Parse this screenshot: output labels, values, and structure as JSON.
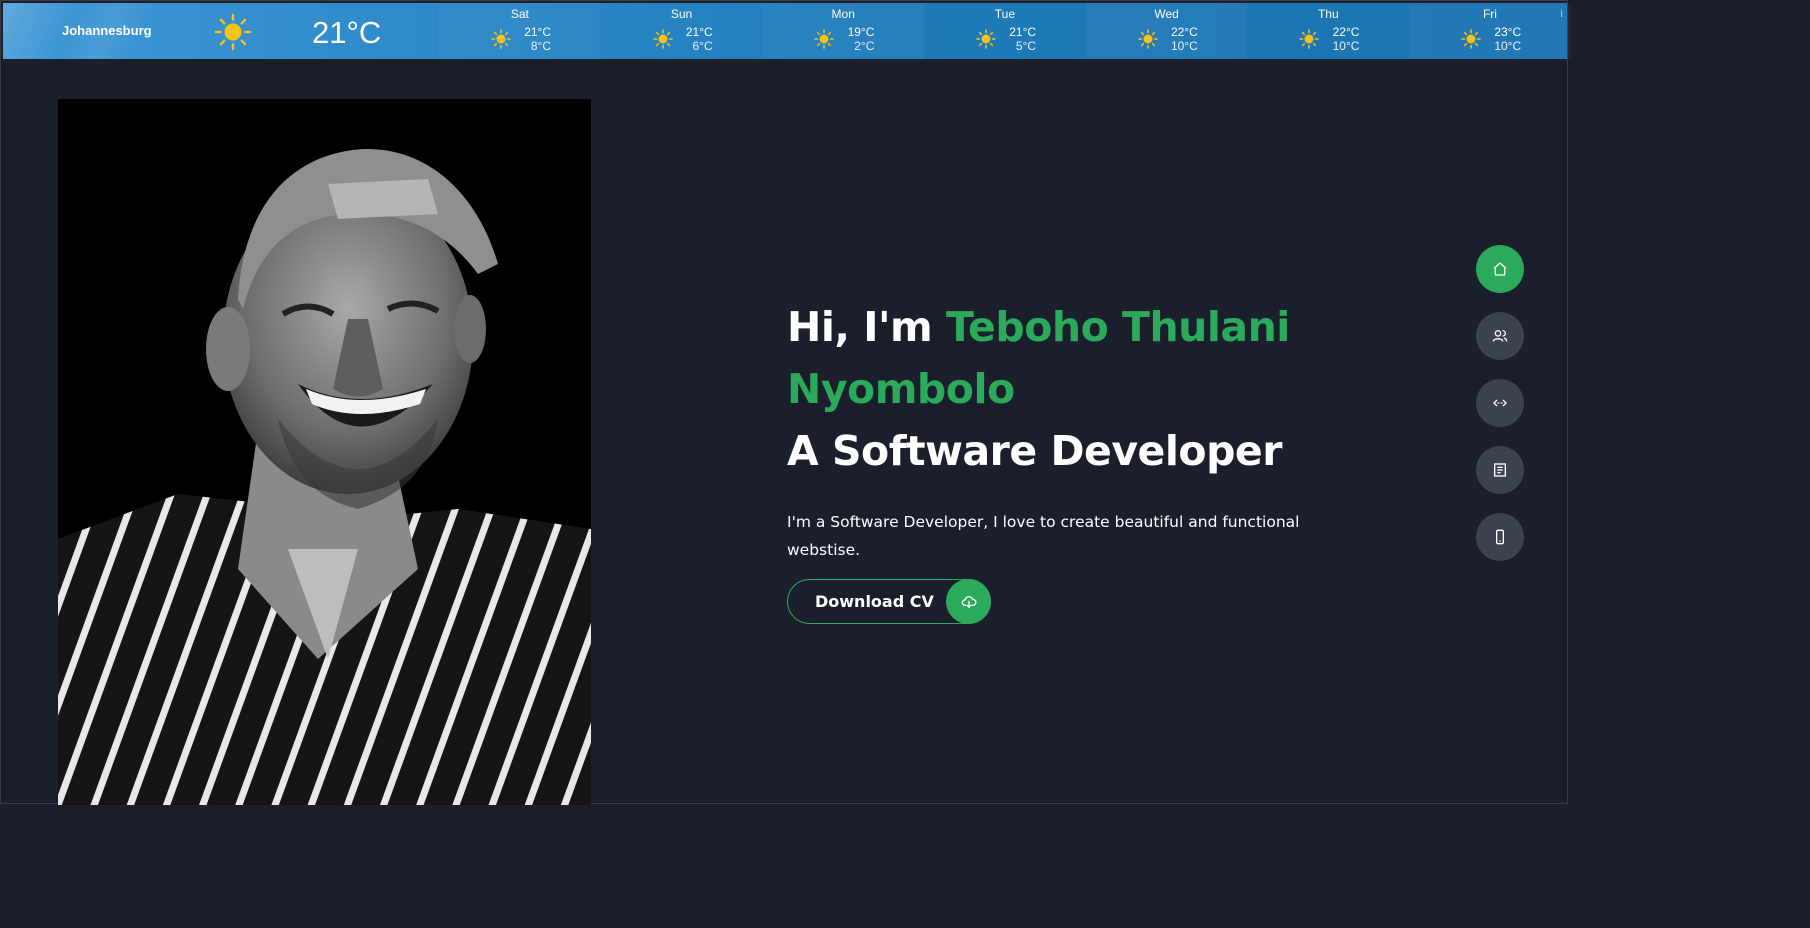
{
  "weather": {
    "city": "Johannesburg",
    "current_temp": "21°C",
    "current_icon": "sun-icon",
    "forecast": [
      {
        "day": "Sat",
        "high": "21°C",
        "low": "8°C",
        "icon": "sun-icon"
      },
      {
        "day": "Sun",
        "high": "21°C",
        "low": "6°C",
        "icon": "sun-icon"
      },
      {
        "day": "Mon",
        "high": "19°C",
        "low": "2°C",
        "icon": "sun-icon"
      },
      {
        "day": "Tue",
        "high": "21°C",
        "low": "5°C",
        "icon": "sun-icon"
      },
      {
        "day": "Wed",
        "high": "22°C",
        "low": "10°C",
        "icon": "sun-icon"
      },
      {
        "day": "Thu",
        "high": "22°C",
        "low": "10°C",
        "icon": "sun-icon"
      },
      {
        "day": "Fri",
        "high": "23°C",
        "low": "10°C",
        "icon": "sun-icon"
      }
    ],
    "info_mark": "i"
  },
  "hero": {
    "greeting": "Hi, I'm ",
    "name": "Teboho Thulani Nyombolo",
    "role": "A Software Developer",
    "description": "I'm a Software Developer, I love to create beautiful and functional webstise.",
    "cv_button": "Download CV",
    "cv_icon": "cloud-download-icon"
  },
  "nav": [
    {
      "name": "home",
      "icon": "home-icon",
      "active": true
    },
    {
      "name": "about",
      "icon": "users-icon",
      "active": false
    },
    {
      "name": "projects",
      "icon": "code-icon",
      "active": false
    },
    {
      "name": "resume",
      "icon": "document-icon",
      "active": false
    },
    {
      "name": "contact",
      "icon": "phone-icon",
      "active": false
    }
  ],
  "colors": {
    "background": "#1b1e2b",
    "accent": "#2aaa5a",
    "nav_inactive": "#3c4250",
    "weather_bar": "#2b88c8"
  }
}
